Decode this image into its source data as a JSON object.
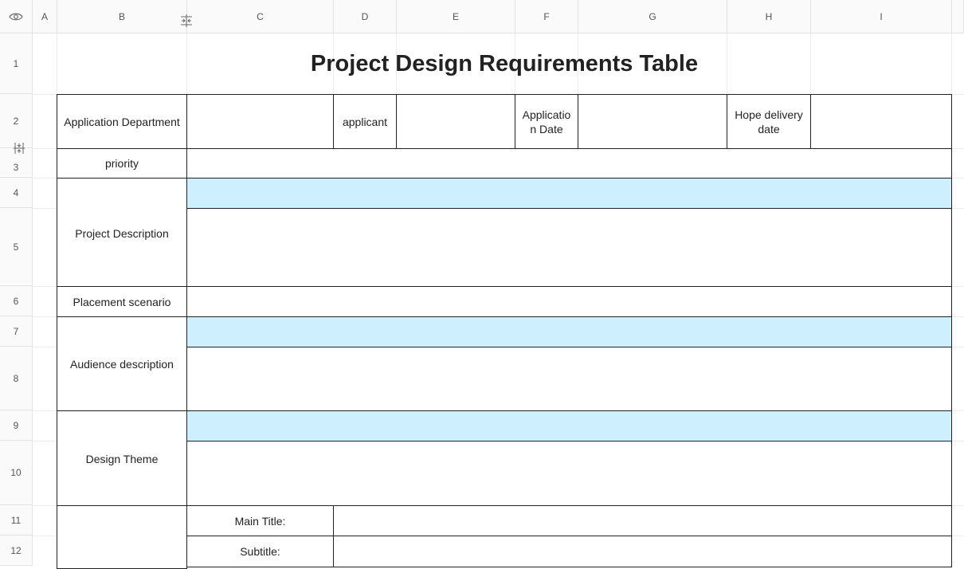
{
  "columns": [
    "A",
    "B",
    "C",
    "D",
    "E",
    "F",
    "G",
    "H",
    "I"
  ],
  "rows": [
    "1",
    "2",
    "3",
    "4",
    "5",
    "6",
    "7",
    "8",
    "9",
    "10",
    "11",
    "12"
  ],
  "title": "Project Design Requirements Table",
  "labels": {
    "application_department": "Application Department",
    "applicant": "applicant",
    "application_date": "Applicatio n Date",
    "hope_delivery_date": "Hope delivery date",
    "priority": "priority",
    "project_description": "Project Description",
    "placement_scenario": "Placement scenario",
    "audience_description": "Audience description",
    "design_theme": "Design Theme",
    "main_title": "Main Title:",
    "subtitle": "Subtitle:"
  },
  "highlight_color": "#cdeffe",
  "icons": {
    "corner": "eye-icon",
    "column_resize": "column-resize-icon",
    "row_resize": "row-resize-icon"
  }
}
